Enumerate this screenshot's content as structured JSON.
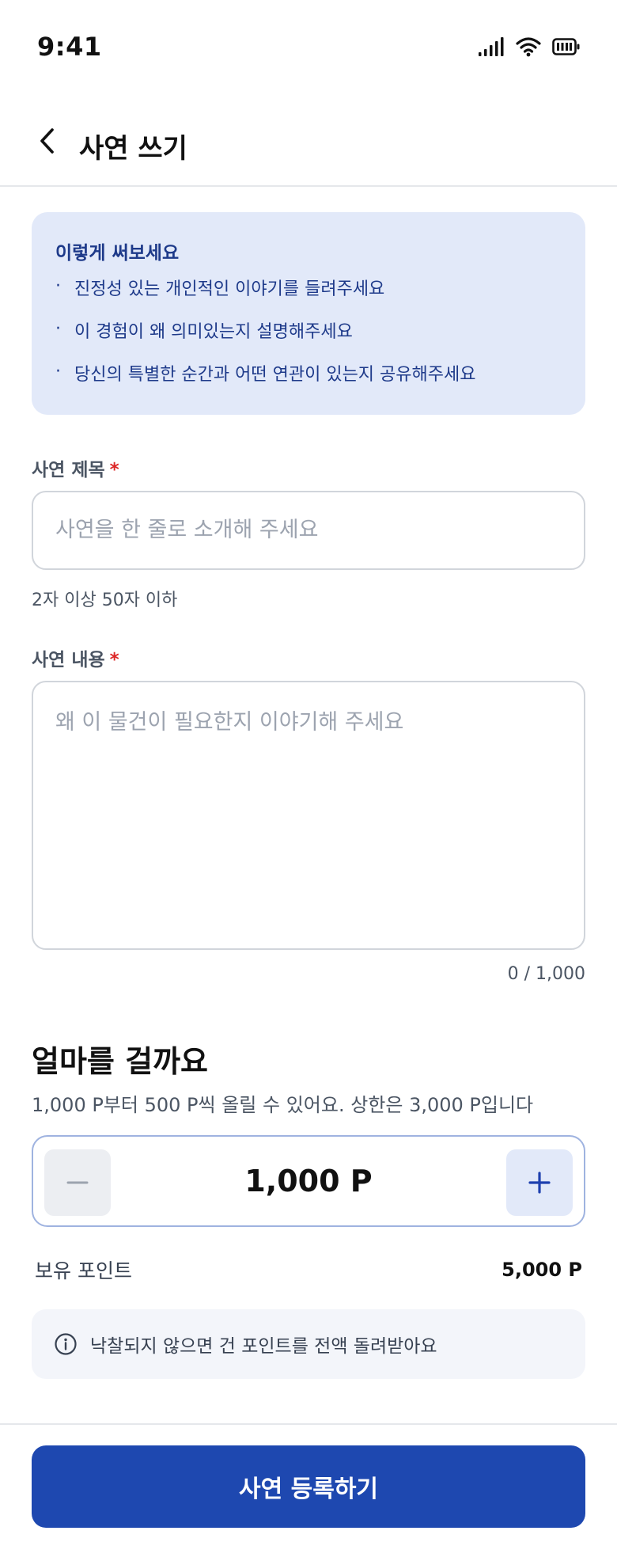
{
  "status_bar": {
    "time": "9:41",
    "icons": [
      "signal-icon",
      "wifi-icon",
      "battery-icon"
    ]
  },
  "nav": {
    "back_icon": "chevron-left-icon",
    "title": "사연 쓰기"
  },
  "tips": {
    "title": "이렇게 써보세요",
    "items": [
      "진정성 있는 개인적인 이야기를 들려주세요",
      "이 경험이 왜 의미있는지 설명해주세요",
      "당신의 특별한 순간과 어떤 연관이 있는지 공유해주세요"
    ]
  },
  "form": {
    "title_label": "사연 제목",
    "title_placeholder": "사연을 한 줄로 소개해 주세요",
    "title_helper": "2자 이상 50자 이하",
    "content_label": "사연 내용",
    "content_placeholder": "왜 이 물건이 필요한지 이야기해 주세요",
    "content_counter": "0 / 1,000",
    "required_mark": "*"
  },
  "bet": {
    "title": "얼마를 걸까요",
    "description": "1,000 P부터 500 P씩 올릴 수 있어요. 상한은 3,000 P입니다",
    "amount": "1,000 P",
    "minus_label": "−",
    "plus_label": "+"
  },
  "points": {
    "label": "보유 포인트",
    "value": "5,000 P"
  },
  "notice": {
    "icon": "info-icon",
    "text": "낙찰되지 않으면 건 포인트를 전액 돌려받아요"
  },
  "submit": {
    "label": "사연 등록하기"
  },
  "colors": {
    "primary": "#1e48b0",
    "tip_background": "#e2e9f9",
    "required": "#dc2626"
  }
}
